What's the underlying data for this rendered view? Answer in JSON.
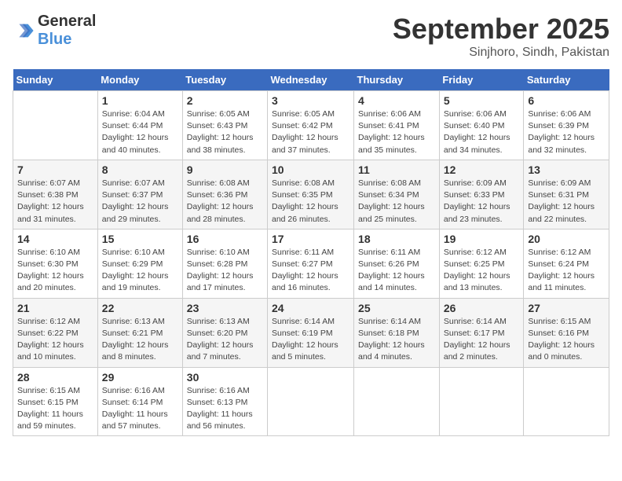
{
  "header": {
    "logo_general": "General",
    "logo_blue": "Blue",
    "month": "September 2025",
    "location": "Sinjhoro, Sindh, Pakistan"
  },
  "weekdays": [
    "Sunday",
    "Monday",
    "Tuesday",
    "Wednesday",
    "Thursday",
    "Friday",
    "Saturday"
  ],
  "weeks": [
    [
      {
        "day": "",
        "sunrise": "",
        "sunset": "",
        "daylight": ""
      },
      {
        "day": "1",
        "sunrise": "Sunrise: 6:04 AM",
        "sunset": "Sunset: 6:44 PM",
        "daylight": "Daylight: 12 hours and 40 minutes."
      },
      {
        "day": "2",
        "sunrise": "Sunrise: 6:05 AM",
        "sunset": "Sunset: 6:43 PM",
        "daylight": "Daylight: 12 hours and 38 minutes."
      },
      {
        "day": "3",
        "sunrise": "Sunrise: 6:05 AM",
        "sunset": "Sunset: 6:42 PM",
        "daylight": "Daylight: 12 hours and 37 minutes."
      },
      {
        "day": "4",
        "sunrise": "Sunrise: 6:06 AM",
        "sunset": "Sunset: 6:41 PM",
        "daylight": "Daylight: 12 hours and 35 minutes."
      },
      {
        "day": "5",
        "sunrise": "Sunrise: 6:06 AM",
        "sunset": "Sunset: 6:40 PM",
        "daylight": "Daylight: 12 hours and 34 minutes."
      },
      {
        "day": "6",
        "sunrise": "Sunrise: 6:06 AM",
        "sunset": "Sunset: 6:39 PM",
        "daylight": "Daylight: 12 hours and 32 minutes."
      }
    ],
    [
      {
        "day": "7",
        "sunrise": "Sunrise: 6:07 AM",
        "sunset": "Sunset: 6:38 PM",
        "daylight": "Daylight: 12 hours and 31 minutes."
      },
      {
        "day": "8",
        "sunrise": "Sunrise: 6:07 AM",
        "sunset": "Sunset: 6:37 PM",
        "daylight": "Daylight: 12 hours and 29 minutes."
      },
      {
        "day": "9",
        "sunrise": "Sunrise: 6:08 AM",
        "sunset": "Sunset: 6:36 PM",
        "daylight": "Daylight: 12 hours and 28 minutes."
      },
      {
        "day": "10",
        "sunrise": "Sunrise: 6:08 AM",
        "sunset": "Sunset: 6:35 PM",
        "daylight": "Daylight: 12 hours and 26 minutes."
      },
      {
        "day": "11",
        "sunrise": "Sunrise: 6:08 AM",
        "sunset": "Sunset: 6:34 PM",
        "daylight": "Daylight: 12 hours and 25 minutes."
      },
      {
        "day": "12",
        "sunrise": "Sunrise: 6:09 AM",
        "sunset": "Sunset: 6:33 PM",
        "daylight": "Daylight: 12 hours and 23 minutes."
      },
      {
        "day": "13",
        "sunrise": "Sunrise: 6:09 AM",
        "sunset": "Sunset: 6:31 PM",
        "daylight": "Daylight: 12 hours and 22 minutes."
      }
    ],
    [
      {
        "day": "14",
        "sunrise": "Sunrise: 6:10 AM",
        "sunset": "Sunset: 6:30 PM",
        "daylight": "Daylight: 12 hours and 20 minutes."
      },
      {
        "day": "15",
        "sunrise": "Sunrise: 6:10 AM",
        "sunset": "Sunset: 6:29 PM",
        "daylight": "Daylight: 12 hours and 19 minutes."
      },
      {
        "day": "16",
        "sunrise": "Sunrise: 6:10 AM",
        "sunset": "Sunset: 6:28 PM",
        "daylight": "Daylight: 12 hours and 17 minutes."
      },
      {
        "day": "17",
        "sunrise": "Sunrise: 6:11 AM",
        "sunset": "Sunset: 6:27 PM",
        "daylight": "Daylight: 12 hours and 16 minutes."
      },
      {
        "day": "18",
        "sunrise": "Sunrise: 6:11 AM",
        "sunset": "Sunset: 6:26 PM",
        "daylight": "Daylight: 12 hours and 14 minutes."
      },
      {
        "day": "19",
        "sunrise": "Sunrise: 6:12 AM",
        "sunset": "Sunset: 6:25 PM",
        "daylight": "Daylight: 12 hours and 13 minutes."
      },
      {
        "day": "20",
        "sunrise": "Sunrise: 6:12 AM",
        "sunset": "Sunset: 6:24 PM",
        "daylight": "Daylight: 12 hours and 11 minutes."
      }
    ],
    [
      {
        "day": "21",
        "sunrise": "Sunrise: 6:12 AM",
        "sunset": "Sunset: 6:22 PM",
        "daylight": "Daylight: 12 hours and 10 minutes."
      },
      {
        "day": "22",
        "sunrise": "Sunrise: 6:13 AM",
        "sunset": "Sunset: 6:21 PM",
        "daylight": "Daylight: 12 hours and 8 minutes."
      },
      {
        "day": "23",
        "sunrise": "Sunrise: 6:13 AM",
        "sunset": "Sunset: 6:20 PM",
        "daylight": "Daylight: 12 hours and 7 minutes."
      },
      {
        "day": "24",
        "sunrise": "Sunrise: 6:14 AM",
        "sunset": "Sunset: 6:19 PM",
        "daylight": "Daylight: 12 hours and 5 minutes."
      },
      {
        "day": "25",
        "sunrise": "Sunrise: 6:14 AM",
        "sunset": "Sunset: 6:18 PM",
        "daylight": "Daylight: 12 hours and 4 minutes."
      },
      {
        "day": "26",
        "sunrise": "Sunrise: 6:14 AM",
        "sunset": "Sunset: 6:17 PM",
        "daylight": "Daylight: 12 hours and 2 minutes."
      },
      {
        "day": "27",
        "sunrise": "Sunrise: 6:15 AM",
        "sunset": "Sunset: 6:16 PM",
        "daylight": "Daylight: 12 hours and 0 minutes."
      }
    ],
    [
      {
        "day": "28",
        "sunrise": "Sunrise: 6:15 AM",
        "sunset": "Sunset: 6:15 PM",
        "daylight": "Daylight: 11 hours and 59 minutes."
      },
      {
        "day": "29",
        "sunrise": "Sunrise: 6:16 AM",
        "sunset": "Sunset: 6:14 PM",
        "daylight": "Daylight: 11 hours and 57 minutes."
      },
      {
        "day": "30",
        "sunrise": "Sunrise: 6:16 AM",
        "sunset": "Sunset: 6:13 PM",
        "daylight": "Daylight: 11 hours and 56 minutes."
      },
      {
        "day": "",
        "sunrise": "",
        "sunset": "",
        "daylight": ""
      },
      {
        "day": "",
        "sunrise": "",
        "sunset": "",
        "daylight": ""
      },
      {
        "day": "",
        "sunrise": "",
        "sunset": "",
        "daylight": ""
      },
      {
        "day": "",
        "sunrise": "",
        "sunset": "",
        "daylight": ""
      }
    ]
  ]
}
